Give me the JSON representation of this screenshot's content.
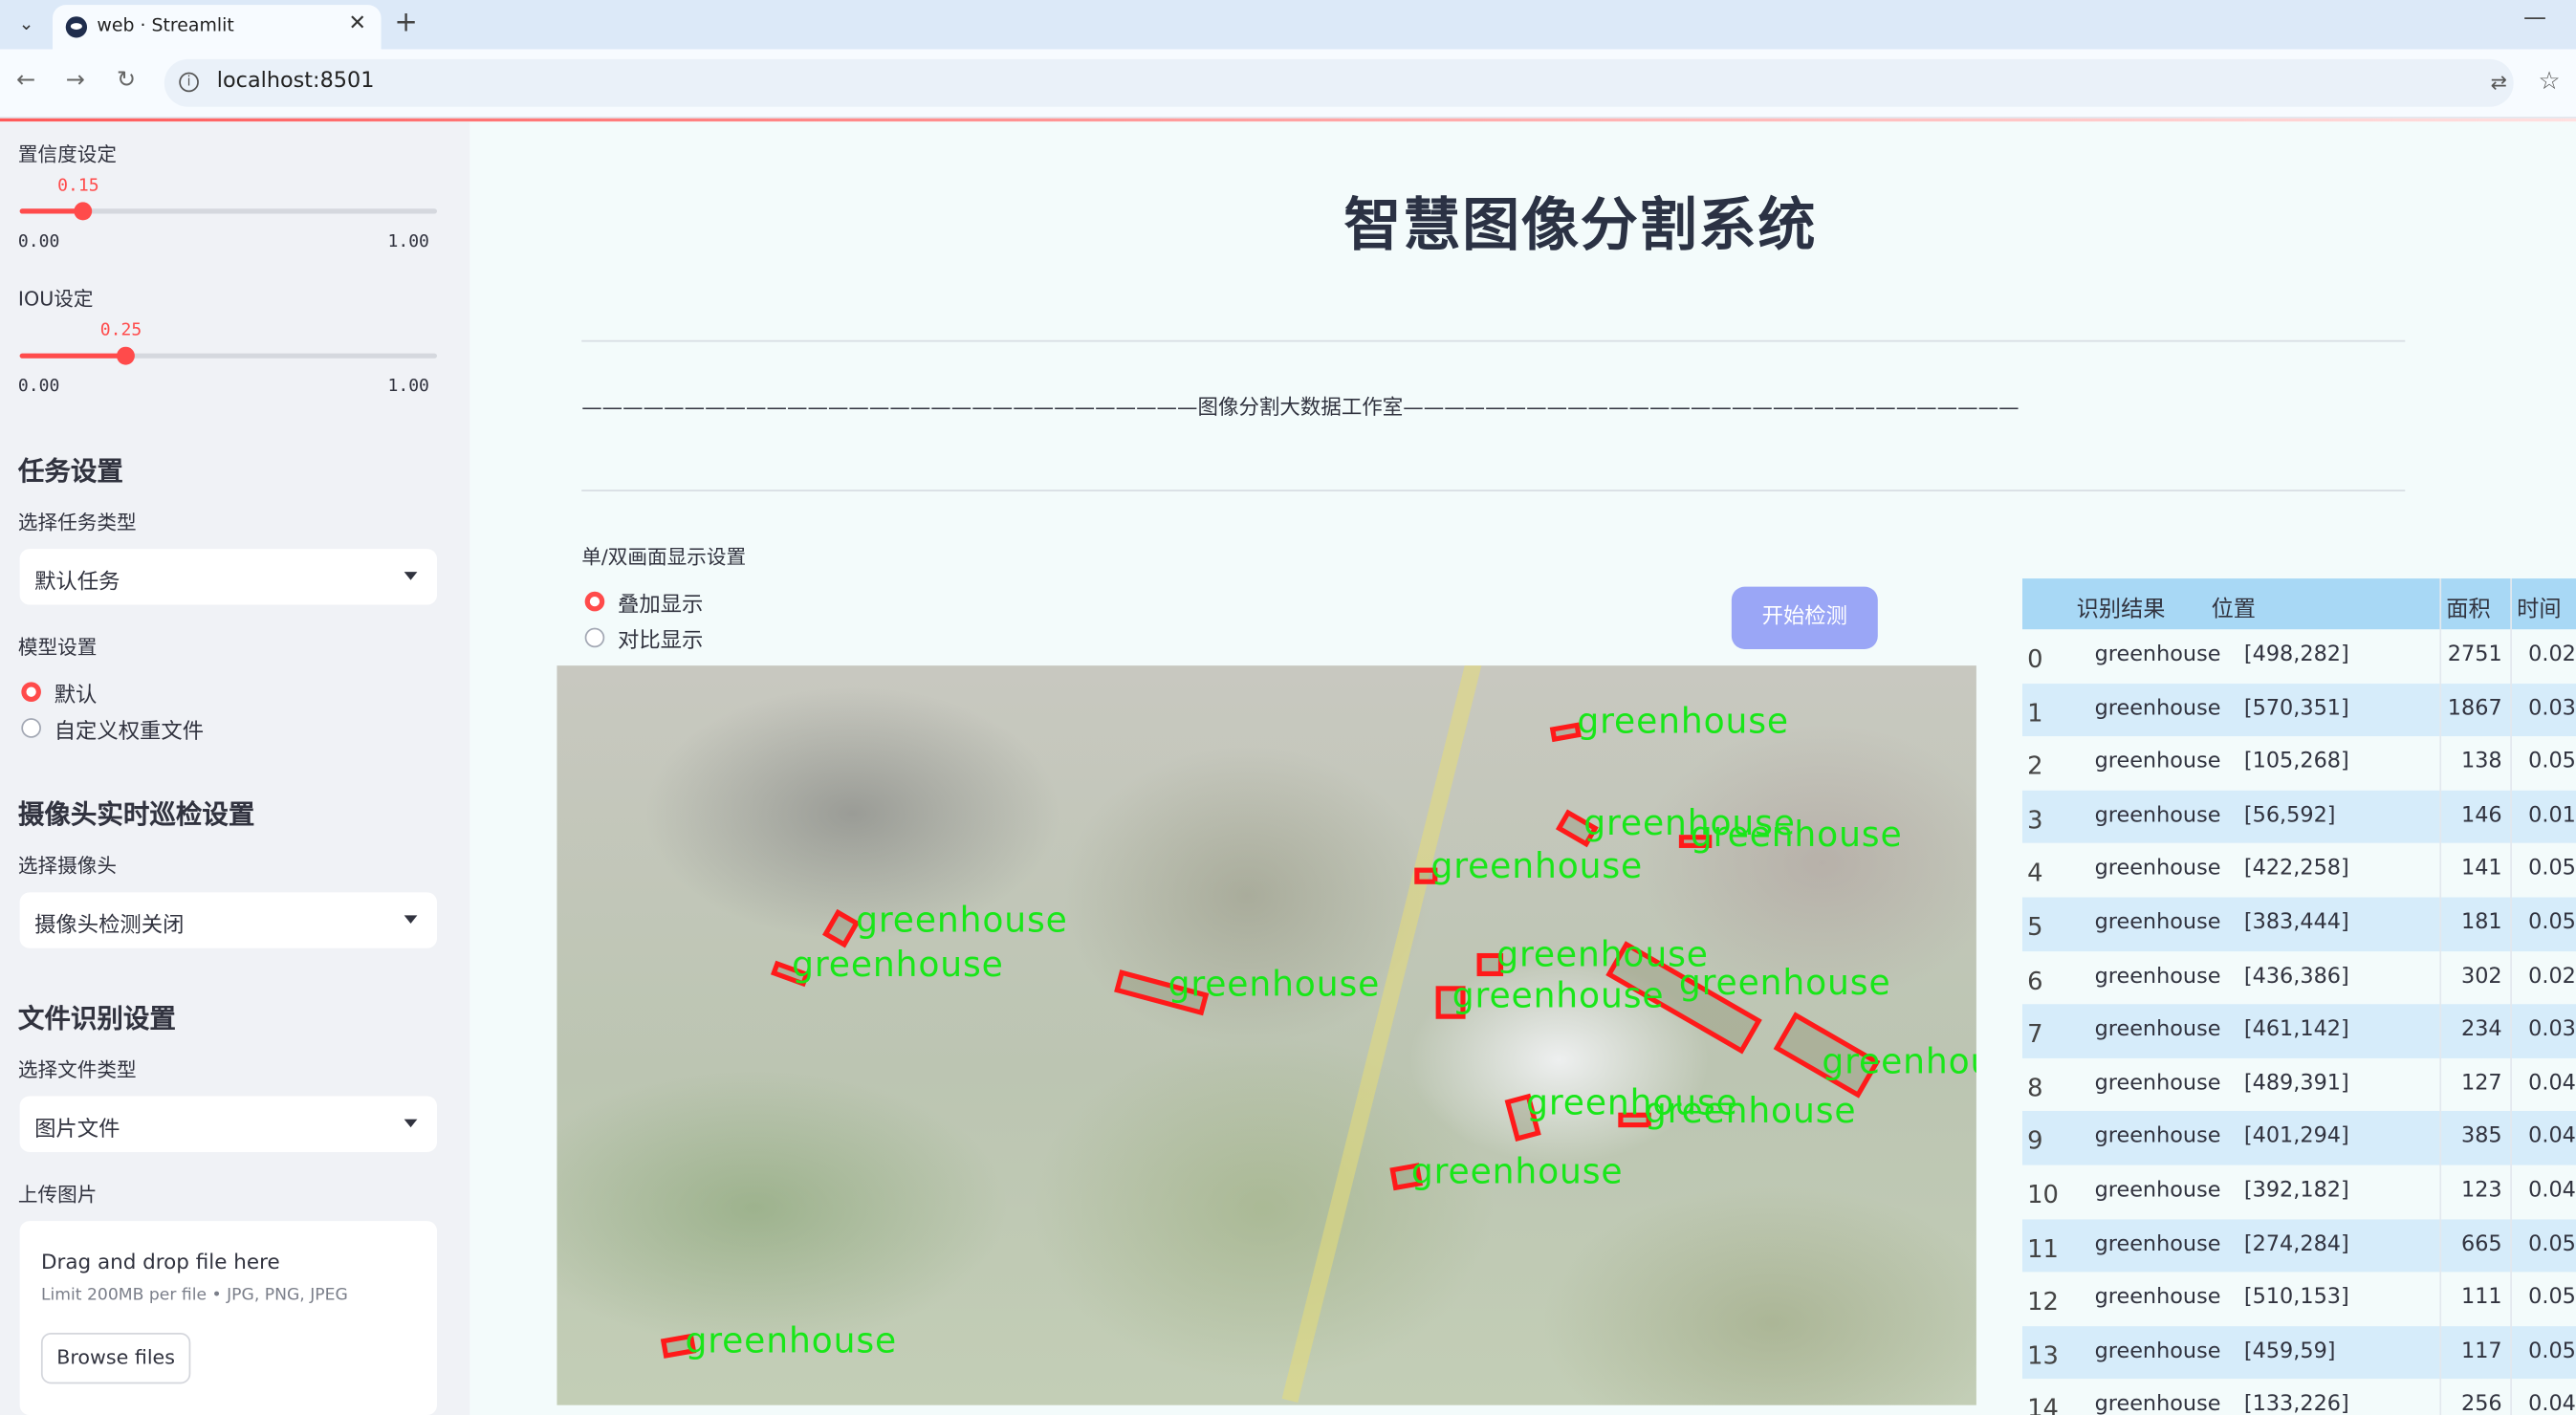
{
  "browser": {
    "tab_title": "web · Streamlit",
    "tab_close": "✕",
    "new_tab": "+",
    "url": "localhost:8501"
  },
  "sidebar": {
    "confidence": {
      "label": "置信度设定",
      "value": "0.15",
      "fraction": 0.15,
      "min": "0.00",
      "max": "1.00"
    },
    "iou": {
      "label": "IOU设定",
      "value": "0.25",
      "fraction": 0.25,
      "min": "0.00",
      "max": "1.00"
    },
    "task_section": "任务设置",
    "task_type_label": "选择任务类型",
    "task_type_value": "默认任务",
    "model_label": "模型设置",
    "model_options": [
      "默认",
      "自定义权重文件"
    ],
    "model_selected": "默认",
    "camera_section": "摄像头实时巡检设置",
    "camera_label": "选择摄像头",
    "camera_value": "摄像头检测关闭",
    "file_section": "文件识别设置",
    "file_type_label": "选择文件类型",
    "file_type_value": "图片文件",
    "upload_label": "上传图片",
    "upload_title": "Drag and drop file here",
    "upload_limit": "Limit 200MB per file • JPG, PNG, JPEG",
    "browse_button": "Browse files"
  },
  "main": {
    "title": "智慧图像分割系统",
    "studio_line": "——————————————————————————————图像分割大数据工作室——————————————————————————————",
    "display_mode_label": "单/双画面显示设置",
    "display_options": [
      "叠加显示",
      "对比显示"
    ],
    "display_selected": "叠加显示",
    "start_button": "开始检测",
    "detection_label": "greenhouse"
  },
  "table": {
    "headers": [
      "",
      "识别结果",
      "位置",
      "面积",
      "时间"
    ],
    "rows": [
      [
        "0",
        "greenhouse",
        "[498,282]",
        "2751",
        "0.02"
      ],
      [
        "1",
        "greenhouse",
        "[570,351]",
        "1867",
        "0.03"
      ],
      [
        "2",
        "greenhouse",
        "[105,268]",
        "138",
        "0.05"
      ],
      [
        "3",
        "greenhouse",
        "[56,592]",
        "146",
        "0.01"
      ],
      [
        "4",
        "greenhouse",
        "[422,258]",
        "141",
        "0.05"
      ],
      [
        "5",
        "greenhouse",
        "[383,444]",
        "181",
        "0.05"
      ],
      [
        "6",
        "greenhouse",
        "[436,386]",
        "302",
        "0.02"
      ],
      [
        "7",
        "greenhouse",
        "[461,142]",
        "234",
        "0.03"
      ],
      [
        "8",
        "greenhouse",
        "[489,391]",
        "127",
        "0.04"
      ],
      [
        "9",
        "greenhouse",
        "[401,294]",
        "385",
        "0.04"
      ],
      [
        "10",
        "greenhouse",
        "[392,182]",
        "123",
        "0.04"
      ],
      [
        "11",
        "greenhouse",
        "[274,284]",
        "665",
        "0.05"
      ],
      [
        "12",
        "greenhouse",
        "[510,153]",
        "111",
        "0.05"
      ],
      [
        "13",
        "greenhouse",
        "[459,59]",
        "117",
        "0.05"
      ],
      [
        "14",
        "greenhouse",
        "[133,226]",
        "256",
        "0.04"
      ]
    ]
  },
  "colors": {
    "accent": "#ff4b4b",
    "sidebar_bg": "#f0f2f6",
    "main_bg": "#f3fbfb",
    "button": "#9aa6f6",
    "table_header": "#a8d8f5",
    "table_alt_row": "#d6ecfa",
    "box": "#ff1a1a",
    "label": "#19e619"
  },
  "icons": [
    "tab-list-icon",
    "streamlit-logo-icon",
    "back-icon",
    "forward-icon",
    "reload-icon",
    "site-info-icon",
    "translate-icon",
    "bookmark-star-icon",
    "minimize-icon",
    "dropdown-arrow-icon"
  ]
}
